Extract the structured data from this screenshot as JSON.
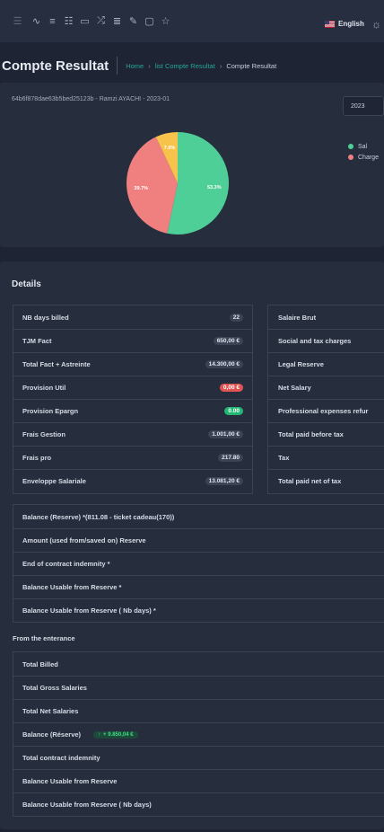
{
  "header": {
    "language": "English"
  },
  "page": {
    "title": "Compte Resultat",
    "breadcrumb": [
      "Home",
      "list Compte Resultat",
      "Compte Resultat"
    ]
  },
  "chart_card": {
    "subtitle": "64b6f878dae63b5bed25123b - Ramzi AYACHI - 2023-01",
    "year": "2023",
    "legend": [
      "Sal",
      "Charge"
    ]
  },
  "chart_data": {
    "type": "pie",
    "labels": [
      "Sal",
      "Charge",
      ""
    ],
    "values": [
      53.3,
      39.7,
      7.0
    ],
    "value_labels": [
      "53.3%",
      "39.7%",
      "7.0%"
    ],
    "colors": [
      "#4fcf98",
      "#f08080",
      "#f7c34a"
    ]
  },
  "details": {
    "title": "Details",
    "left": [
      {
        "label": "NB days billed",
        "value": "22",
        "style": "dark"
      },
      {
        "label": "TJM Fact",
        "value": "650,00 €",
        "style": "dark"
      },
      {
        "label": "Total Fact + Astreinte",
        "value": "14.300,00 €",
        "style": "dark"
      },
      {
        "label": "Provision Util",
        "value": "0,00 €",
        "style": "red"
      },
      {
        "label": "Provision Epargn",
        "value": "0.00",
        "style": "green"
      },
      {
        "label": "Frais Gestion",
        "value": "1.001,00 €",
        "style": "dark"
      },
      {
        "label": "Frais pro",
        "value": "217.80",
        "style": "dark"
      },
      {
        "label": "Enveloppe Salariale",
        "value": "13.081,20 €",
        "style": "dark"
      }
    ],
    "right": [
      "Salaire Brut",
      "Social and tax charges",
      "Legal Reserve",
      "Net Salary",
      "Professional expenses refur",
      "Total paid before tax",
      "Tax",
      "Total paid net of tax"
    ],
    "balance": [
      "Balance (Reserve) *(811.08 - ticket cadeau(170))",
      "Amount (used from/saved on) Reserve",
      "End of contract indemnity *",
      "Balance Usable from Reserve *",
      "Balance Usable from Reserve ( Nb days) *"
    ],
    "entrance_title": "From the enterance",
    "entrance": [
      "Total Billed",
      "Total Gross Salaries",
      "Total Net Salaries",
      "Balance (Réserve)",
      "Total contract indemnity",
      "Balance Usable from Reserve",
      "Balance Usable from Reserve ( Nb days)"
    ],
    "reserve_badge": "+ 9.850,04 €"
  }
}
